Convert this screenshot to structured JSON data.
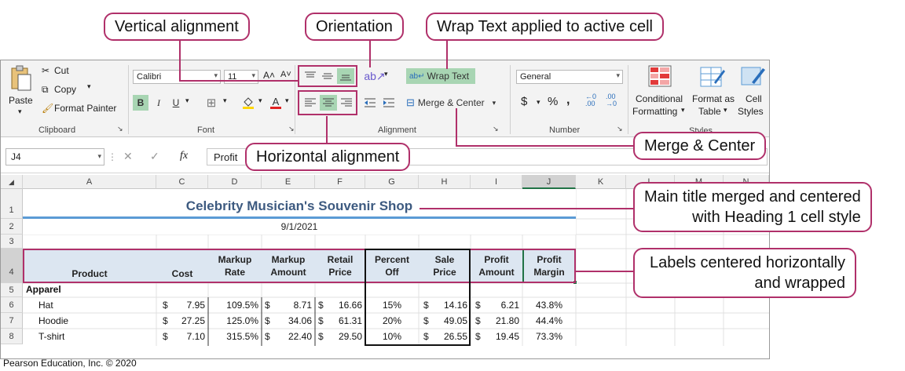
{
  "callouts": {
    "vertical_alignment": "Vertical alignment",
    "orientation": "Orientation",
    "wrap_text_active": "Wrap Text applied to active cell",
    "horizontal_alignment": "Horizontal alignment",
    "merge_center": "Merge & Center",
    "main_title_line1": "Main title merged and centered",
    "main_title_line2": "with Heading 1 cell style",
    "labels_line1": "Labels centered horizontally",
    "labels_line2": "and wrapped"
  },
  "ribbon": {
    "clipboard": {
      "paste": "Paste",
      "cut": "Cut",
      "copy": "Copy",
      "format_painter": "Format Painter",
      "label": "Clipboard"
    },
    "font": {
      "font_name": "Calibri",
      "font_size": "11",
      "grow": "A˄",
      "shrink": "A˅",
      "bold": "B",
      "italic": "I",
      "underline": "U",
      "label": "Font"
    },
    "alignment": {
      "wrap_text": "Wrap Text",
      "merge_center": "Merge & Center",
      "label": "Alignment"
    },
    "number": {
      "format": "General",
      "dollar": "$",
      "percent": "%",
      "comma": "̹",
      "inc_dec": "←.0 .00",
      "dec_dec": ".00 →.0",
      "label": "Number"
    },
    "styles": {
      "conditional": "Conditional",
      "formatting": "Formatting",
      "format_as": "Format as",
      "table": "Table",
      "cell": "Cell",
      "styles_label": "Styles",
      "label": "Styles"
    }
  },
  "formula_bar": {
    "name_box": "J4",
    "fx": "fx",
    "content": "Profit"
  },
  "colors": {
    "accent": "#b0306a",
    "highlight": "#a8d5b3",
    "header_fill": "#dce6f1",
    "title_color": "#3d5a80",
    "rule": "#5b9bd5"
  },
  "columns": [
    "A",
    "C",
    "D",
    "E",
    "F",
    "G",
    "H",
    "I",
    "J",
    "K",
    "L",
    "M",
    "N"
  ],
  "rows": [
    "1",
    "2",
    "3",
    "4",
    "5",
    "6",
    "7",
    "8"
  ],
  "sheet": {
    "title": "Celebrity Musician's Souvenir Shop",
    "date": "9/1/2021",
    "headers": {
      "product": "Product",
      "cost": "Cost",
      "markup_rate_1": "Markup",
      "markup_rate_2": "Rate",
      "markup_amount_1": "Markup",
      "markup_amount_2": "Amount",
      "retail_price_1": "Retail",
      "retail_price_2": "Price",
      "percent_off_1": "Percent",
      "percent_off_2": "Off",
      "sale_price_1": "Sale",
      "sale_price_2": "Price",
      "profit_amount_1": "Profit",
      "profit_amount_2": "Amount",
      "profit_margin_1": "Profit",
      "profit_margin_2": "Margin"
    },
    "category": "Apparel",
    "items": [
      {
        "name": "Hat",
        "cost": "7.95",
        "markup_rate": "109.5%",
        "markup_amount": "8.71",
        "retail": "16.66",
        "percent_off": "15%",
        "sale": "14.16",
        "profit": "6.21",
        "margin": "43.8%"
      },
      {
        "name": "Hoodie",
        "cost": "27.25",
        "markup_rate": "125.0%",
        "markup_amount": "34.06",
        "retail": "61.31",
        "percent_off": "20%",
        "sale": "49.05",
        "profit": "21.80",
        "margin": "44.4%"
      },
      {
        "name": "T-shirt",
        "cost": "7.10",
        "markup_rate": "315.5%",
        "markup_amount": "22.40",
        "retail": "29.50",
        "percent_off": "10%",
        "sale": "26.55",
        "profit": "19.45",
        "margin": "73.3%"
      }
    ],
    "currency": "$"
  },
  "credit": "Pearson Education, Inc. © 2020"
}
